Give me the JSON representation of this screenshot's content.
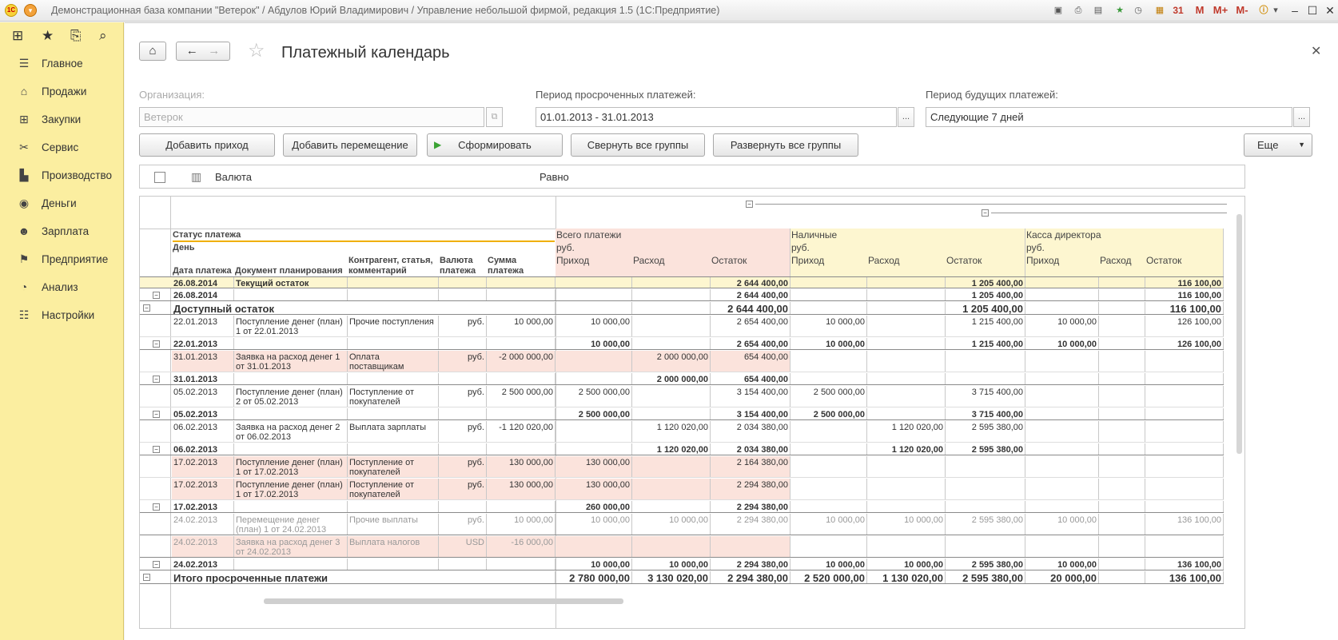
{
  "window": {
    "title": "Демонстрационная база компании \"Ветерок\" / Абдулов Юрий Владимирович / Управление небольшой фирмой, редакция 1.5  (1С:Предприятие)",
    "toolbar_icons": [
      "save-icon",
      "print-icon",
      "preview-icon",
      "favorites-icon",
      "history-icon",
      "calculator-icon",
      "calendar-icon"
    ],
    "mem": [
      "M",
      "M+",
      "M-"
    ]
  },
  "sidebar": {
    "items": [
      {
        "label": "Главное",
        "icon": "menu-icon"
      },
      {
        "label": "Продажи",
        "icon": "basket-icon"
      },
      {
        "label": "Закупки",
        "icon": "cart-icon"
      },
      {
        "label": "Сервис",
        "icon": "tools-icon"
      },
      {
        "label": "Производство",
        "icon": "factory-icon"
      },
      {
        "label": "Деньги",
        "icon": "money-icon"
      },
      {
        "label": "Зарплата",
        "icon": "people-icon"
      },
      {
        "label": "Предприятие",
        "icon": "flag-icon"
      },
      {
        "label": "Анализ",
        "icon": "pie-icon"
      },
      {
        "label": "Настройки",
        "icon": "settings-icon"
      }
    ]
  },
  "page": {
    "title": "Платежный календарь",
    "org_label": "Организация:",
    "org_value": "Ветерок",
    "overdue_label": "Период просроченных платежей:",
    "overdue_value": "01.01.2013 - 31.01.2013",
    "future_label": "Период будущих платежей:",
    "future_value": "Следующие 7 дней",
    "dots": "...",
    "buttons": {
      "add_income": "Добавить приход",
      "add_move": "Добавить перемещение",
      "generate": "Сформировать",
      "collapse": "Свернуть все группы",
      "expand": "Развернуть все группы",
      "more": "Еще"
    },
    "filter": {
      "field": "Валюта",
      "cond": "Равно"
    }
  },
  "grid": {
    "head": {
      "status": "Статус платежа",
      "day": "День",
      "cols": [
        "Дата платежа",
        "Документ планирования",
        "Контрагент, статья, комментарий",
        "Валюта платежа",
        "Сумма платежа"
      ],
      "groups": [
        {
          "name": "Всего платежи",
          "cur": "руб."
        },
        {
          "name": "Наличные",
          "cur": "руб."
        },
        {
          "name": "Касса директора",
          "cur": "руб."
        }
      ],
      "sub": [
        "Приход",
        "Расход",
        "Остаток"
      ]
    },
    "rows": [
      {
        "kind": "ylw-b",
        "date": "26.08.2014",
        "doc": "Текущий остаток",
        "ctr": "",
        "cur": "",
        "sum": "",
        "v": [
          "",
          "",
          "2 644 400,00",
          "",
          "",
          "1 205 400,00",
          "",
          "",
          "116 100,00"
        ]
      },
      {
        "kind": "group",
        "date": "26.08.2014",
        "doc": "",
        "ctr": "",
        "cur": "",
        "sum": "",
        "v": [
          "",
          "",
          "2 644 400,00",
          "",
          "",
          "1 205 400,00",
          "",
          "",
          "116 100,00"
        ]
      },
      {
        "kind": "big",
        "date": "Доступный остаток",
        "doc": "",
        "ctr": "",
        "cur": "",
        "sum": "",
        "v": [
          "",
          "",
          "2 644 400,00",
          "",
          "",
          "1 205 400,00",
          "",
          "",
          "116 100,00"
        ]
      },
      {
        "kind": "item",
        "date": "22.01.2013",
        "doc": "Поступление денег (план) 1 от 22.01.2013",
        "ctr": "Прочие поступления",
        "cur": "руб.",
        "sum": "10 000,00",
        "v": [
          "10 000,00",
          "",
          "2 654 400,00",
          "10 000,00",
          "",
          "1 215 400,00",
          "10 000,00",
          "",
          "126 100,00"
        ]
      },
      {
        "kind": "group",
        "date": "22.01.2013",
        "doc": "",
        "ctr": "",
        "cur": "",
        "sum": "",
        "v": [
          "10 000,00",
          "",
          "2 654 400,00",
          "10 000,00",
          "",
          "1 215 400,00",
          "10 000,00",
          "",
          "126 100,00"
        ]
      },
      {
        "kind": "item-pink",
        "date": "31.01.2013",
        "doc": "Заявка на расход денег 1 от 31.01.2013",
        "ctr": "Оплата поставщикам",
        "cur": "руб.",
        "sum": "-2 000 000,00",
        "v": [
          "",
          "2 000 000,00",
          "654 400,00",
          "",
          "",
          "",
          "",
          "",
          ""
        ]
      },
      {
        "kind": "group",
        "date": "31.01.2013",
        "doc": "",
        "ctr": "",
        "cur": "",
        "sum": "",
        "v": [
          "",
          "2 000 000,00",
          "654 400,00",
          "",
          "",
          "",
          "",
          "",
          ""
        ]
      },
      {
        "kind": "item",
        "date": "05.02.2013",
        "doc": "Поступление денег (план) 2 от 05.02.2013",
        "ctr": "Поступление от покупателей",
        "cur": "руб.",
        "sum": "2 500 000,00",
        "v": [
          "2 500 000,00",
          "",
          "3 154 400,00",
          "2 500 000,00",
          "",
          "3 715 400,00",
          "",
          "",
          ""
        ]
      },
      {
        "kind": "group",
        "date": "05.02.2013",
        "doc": "",
        "ctr": "",
        "cur": "",
        "sum": "",
        "v": [
          "2 500 000,00",
          "",
          "3 154 400,00",
          "2 500 000,00",
          "",
          "3 715 400,00",
          "",
          "",
          ""
        ]
      },
      {
        "kind": "item",
        "date": "06.02.2013",
        "doc": "Заявка на расход денег 2 от 06.02.2013",
        "ctr": "Выплата зарплаты",
        "cur": "руб.",
        "sum": "-1 120 020,00",
        "v": [
          "",
          "1 120 020,00",
          "2 034 380,00",
          "",
          "1 120 020,00",
          "2 595 380,00",
          "",
          "",
          ""
        ]
      },
      {
        "kind": "group",
        "date": "06.02.2013",
        "doc": "",
        "ctr": "",
        "cur": "",
        "sum": "",
        "v": [
          "",
          "1 120 020,00",
          "2 034 380,00",
          "",
          "1 120 020,00",
          "2 595 380,00",
          "",
          "",
          ""
        ]
      },
      {
        "kind": "item-pink",
        "date": "17.02.2013",
        "doc": "Поступление денег (план) 1 от 17.02.2013",
        "ctr": "Поступление от покупателей",
        "cur": "руб.",
        "sum": "130 000,00",
        "v": [
          "130 000,00",
          "",
          "2 164 380,00",
          "",
          "",
          "",
          "",
          "",
          ""
        ]
      },
      {
        "kind": "item-pink",
        "date": "17.02.2013",
        "doc": "Поступление денег (план) 1 от 17.02.2013",
        "ctr": "Поступление от покупателей",
        "cur": "руб.",
        "sum": "130 000,00",
        "v": [
          "130 000,00",
          "",
          "2 294 380,00",
          "",
          "",
          "",
          "",
          "",
          ""
        ]
      },
      {
        "kind": "group",
        "date": "17.02.2013",
        "doc": "",
        "ctr": "",
        "cur": "",
        "sum": "",
        "v": [
          "260 000,00",
          "",
          "2 294 380,00",
          "",
          "",
          "",
          "",
          "",
          ""
        ]
      },
      {
        "kind": "item-gray",
        "date": "24.02.2013",
        "doc": "Перемещение денег (план) 1 от 24.02.2013",
        "ctr": "Прочие выплаты",
        "cur": "руб.",
        "sum": "10 000,00",
        "v": [
          "10 000,00",
          "10 000,00",
          "2 294 380,00",
          "10 000,00",
          "10 000,00",
          "2 595 380,00",
          "10 000,00",
          "",
          "136 100,00"
        ]
      },
      {
        "kind": "item-gray-pink",
        "date": "24.02.2013",
        "doc": "Заявка на расход денег 3 от 24.02.2013",
        "ctr": "Выплата налогов",
        "cur": "USD",
        "sum": "-16 000,00",
        "v": [
          "",
          "",
          "",
          "",
          "",
          "",
          "",
          "",
          ""
        ]
      },
      {
        "kind": "group",
        "date": "24.02.2013",
        "doc": "",
        "ctr": "",
        "cur": "",
        "sum": "",
        "v": [
          "10 000,00",
          "10 000,00",
          "2 294 380,00",
          "10 000,00",
          "10 000,00",
          "2 595 380,00",
          "10 000,00",
          "",
          "136 100,00"
        ]
      },
      {
        "kind": "big",
        "date": "Итого просроченные платежи",
        "doc": "",
        "ctr": "",
        "cur": "",
        "sum": "",
        "v": [
          "2 780 000,00",
          "3 130 020,00",
          "2 294 380,00",
          "2 520 000,00",
          "1 130 020,00",
          "2 595 380,00",
          "20 000,00",
          "",
          "136 100,00"
        ]
      }
    ]
  }
}
